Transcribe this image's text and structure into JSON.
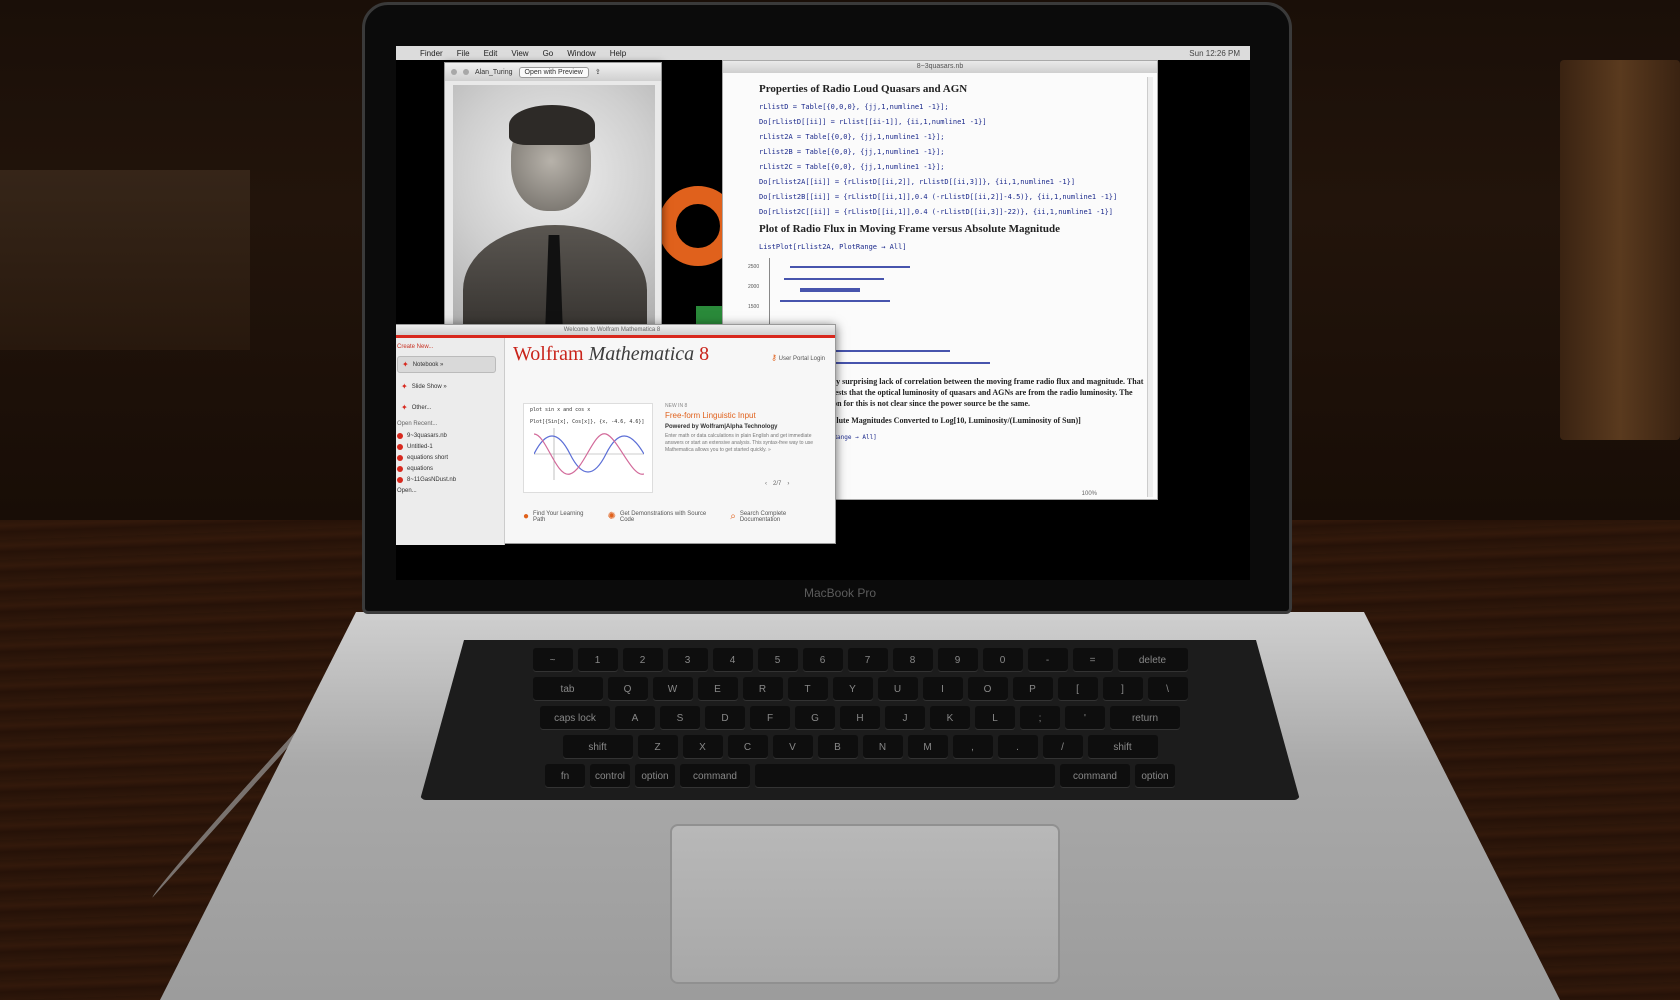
{
  "device": {
    "label": "MacBook Pro"
  },
  "menubar": {
    "items": [
      "Finder",
      "File",
      "Edit",
      "View",
      "Go",
      "Window",
      "Help"
    ],
    "status": "Sun 12:26 PM"
  },
  "preview_window": {
    "title": "Alan_Turing",
    "open_button": "Open with Preview"
  },
  "notebook": {
    "title": "8~3quasars.nb",
    "heading1": "Properties of Radio Loud Quasars and AGN",
    "code_lines": [
      "rLlistD = Table[{0,0,0}, {jj,1,numline1 -1}];",
      "Do[rLlistD[[ii]] = rLlist[[ii-1]], {ii,1,numline1 -1}]",
      "rLlist2A = Table[{0,0}, {jj,1,numline1 -1}];",
      "rLlist2B = Table[{0,0}, {jj,1,numline1 -1}];",
      "rLlist2C = Table[{0,0}, {jj,1,numline1 -1}];",
      "Do[rLlist2A[[ii]] = {rLlistD[[ii,2]], rLlistD[[ii,3]]}, {ii,1,numline1 -1}]",
      "Do[rLlist2B[[ii]] = {rLlistD[[ii,1]],0.4 (-rLlistD[[ii,2]]-4.5)}, {ii,1,numline1 -1}]",
      "Do[rLlist2C[[ii]] = {rLlistD[[ii,1]],0.4 (-rLlistD[[ii,3]]-22)}, {ii,1,numline1 -1}]"
    ],
    "heading2": "Plot of Radio Flux in Moving Frame versus Absolute Magnitude",
    "plot_code": "ListPlot[rLlist2A, PlotRange → All]",
    "plot_ticks": [
      "2500",
      "2000",
      "1500"
    ],
    "text": "a very surprising lack of correlation between the moving frame radio flux and magnitude. That suggests that the optical luminosity of quasars and AGNs are from the radio luminosity. The reason for this is not clear since the power source be the same.",
    "heading3": "Absolute Magnitudes Converted to Log[10, Luminosity/(Luminosity of Sun)]",
    "plot_code2": "PlotRange → All]",
    "zoom": "100%"
  },
  "welcome": {
    "title": "Welcome to Wolfram Mathematica 8",
    "create_new": "Create New...",
    "create_items": [
      "Notebook »",
      "Slide Show »",
      "Other..."
    ],
    "open_recent": "Open Recent...",
    "recent_items": [
      "9~3quasars.nb",
      "Untitled-1",
      "equations short",
      "equations",
      "8~11GasNDust.nb",
      "Open..."
    ],
    "logo_wolfram": "Wolfram",
    "logo_mathematica": "Mathematica",
    "logo_version": "8",
    "portal_login": "User Portal Login",
    "demo_code_1": "plot sin x and cos x",
    "demo_code_2": "Plot[{Sin[x], Cos[x]}, {x, -4.6, 4.6}]",
    "new_label": "NEW IN 8",
    "feature_title": "Free-form Linguistic Input",
    "feature_powered": "Powered by Wolfram|Alpha Technology",
    "feature_desc": "Enter math or data calculations in plain English and get immediate answers or start an extensive analysis. This syntax-free way to use Mathematica allows you to get started quickly. »",
    "pager": "2/7",
    "links": [
      {
        "label": "Find Your Learning Path"
      },
      {
        "label": "Get Demonstrations with Source Code"
      },
      {
        "label": "Search Complete Documentation"
      }
    ]
  },
  "keyboard": {
    "row1": [
      "~",
      "1",
      "2",
      "3",
      "4",
      "5",
      "6",
      "7",
      "8",
      "9",
      "0",
      "-",
      "=",
      "delete"
    ],
    "row2": [
      "tab",
      "Q",
      "W",
      "E",
      "R",
      "T",
      "Y",
      "U",
      "I",
      "O",
      "P",
      "[",
      "]",
      "\\"
    ],
    "row3": [
      "caps lock",
      "A",
      "S",
      "D",
      "F",
      "G",
      "H",
      "J",
      "K",
      "L",
      ";",
      "'",
      "return"
    ],
    "row4": [
      "shift",
      "Z",
      "X",
      "C",
      "V",
      "B",
      "N",
      "M",
      ",",
      ".",
      "/",
      "shift"
    ],
    "row5": [
      "fn",
      "control",
      "option",
      "command",
      "",
      "command",
      "option"
    ]
  }
}
